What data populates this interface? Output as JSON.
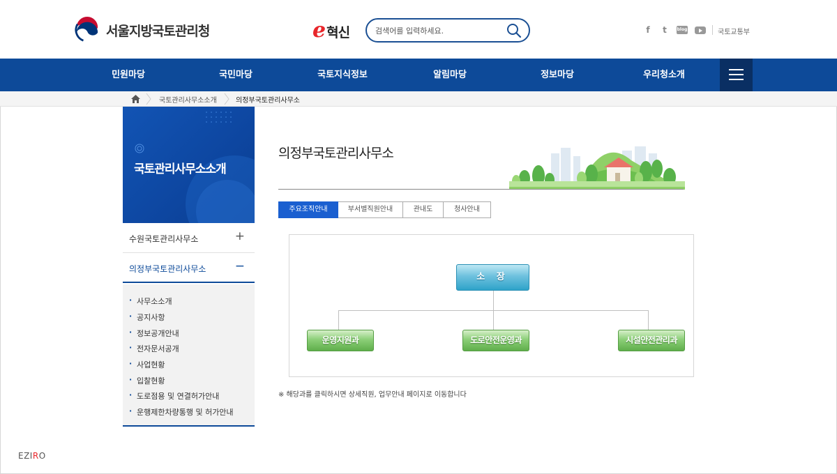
{
  "header": {
    "org_name": "서울지방국토관리청",
    "einno_mark": "e",
    "einno_text": "혁신",
    "search_placeholder": "검색어를 입력하세요.",
    "sns_icons": [
      "facebook-icon",
      "twitter-icon",
      "blog-icon",
      "youtube-icon"
    ],
    "sns_facebook": "f",
    "sns_twitter": "t",
    "sns_blog": "blog",
    "molit_link": "국토교통부"
  },
  "gnb": {
    "items": [
      "민원마당",
      "국민마당",
      "국토지식정보",
      "알림마당",
      "정보마당",
      "우리청소개"
    ]
  },
  "breadcrumb": {
    "items": [
      "국토관리사무소소개",
      "의정부국토관리사무소"
    ]
  },
  "sidebar": {
    "title": "국토관리사무소소개",
    "items": [
      {
        "label": "수원국토관리사무소",
        "toggle": "+"
      },
      {
        "label": "의정부국토관리사무소",
        "toggle": "−"
      }
    ],
    "sub_items": [
      "사무소소개",
      "공지사항",
      "정보공개안내",
      "전자문서공개",
      "사업현황",
      "입찰현황",
      "도로점용 및 연결허가안내",
      "운행제한차량통행 및 허가안내"
    ]
  },
  "content": {
    "title": "의정부국토관리사무소",
    "tabs": [
      "주요조직안내",
      "부서별직원안내",
      "관내도",
      "청사안내"
    ],
    "active_tab": "주요조직안내",
    "org_chart": {
      "head": "소 장",
      "departments": [
        "운영지원과",
        "도로안전운영과",
        "시설안전관리과"
      ]
    },
    "note": "※ 해당과를 클릭하시면 상세직원, 업무안내 페이지로 이동합니다"
  },
  "watermark": {
    "prefix": "EZI",
    "accent": "R",
    "suffix": "O"
  },
  "colors": {
    "brand_blue": "#0d4a99",
    "tab_active": "#1a5fd0",
    "dept_green": "#6dbb58",
    "head_teal": "#4db3d6"
  }
}
